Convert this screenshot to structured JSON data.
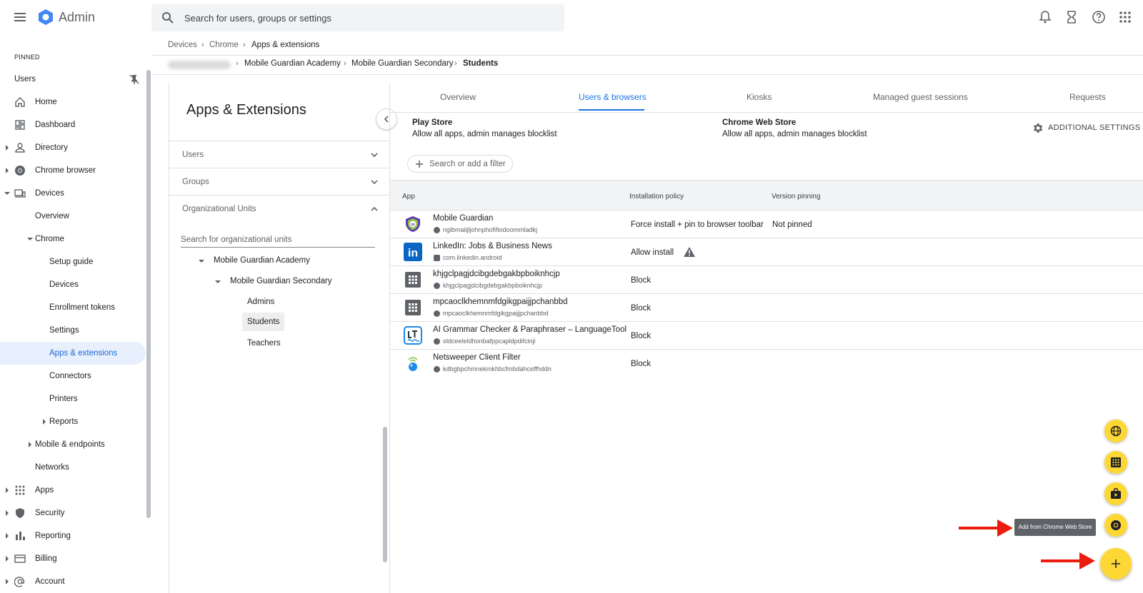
{
  "header": {
    "app_title": "Admin",
    "search_placeholder": "Search for users, groups or settings"
  },
  "sidebar": {
    "pinned_label": "PINNED",
    "pinned_item": "Users",
    "items": [
      {
        "label": "Home"
      },
      {
        "label": "Dashboard"
      },
      {
        "label": "Directory"
      },
      {
        "label": "Chrome browser"
      },
      {
        "label": "Devices"
      },
      {
        "label": "Overview"
      },
      {
        "label": "Chrome"
      },
      {
        "label": "Setup guide"
      },
      {
        "label": "Devices"
      },
      {
        "label": "Enrollment tokens"
      },
      {
        "label": "Settings"
      },
      {
        "label": "Apps & extensions"
      },
      {
        "label": "Connectors"
      },
      {
        "label": "Printers"
      },
      {
        "label": "Reports"
      },
      {
        "label": "Mobile & endpoints"
      },
      {
        "label": "Networks"
      },
      {
        "label": "Apps"
      },
      {
        "label": "Security"
      },
      {
        "label": "Reporting"
      },
      {
        "label": "Billing"
      },
      {
        "label": "Account"
      }
    ]
  },
  "breadcrumb1": [
    "Devices",
    "Chrome",
    "Apps & extensions"
  ],
  "breadcrumb2": [
    "Mobile Guardian Academy",
    "Mobile Guardian Secondary",
    "Students"
  ],
  "left_panel": {
    "title": "Apps & Extensions",
    "sections": [
      "Users",
      "Groups",
      "Organizational Units"
    ],
    "ou_search_placeholder": "Search for organizational units",
    "ou_tree": [
      "Mobile Guardian Academy",
      "Mobile Guardian Secondary",
      "Admins",
      "Students",
      "Teachers"
    ]
  },
  "tabs": [
    "Overview",
    "Users & browsers",
    "Kiosks",
    "Managed guest sessions",
    "Requests"
  ],
  "stores": [
    {
      "title": "Play Store",
      "desc": "Allow all apps, admin manages blocklist"
    },
    {
      "title": "Chrome Web Store",
      "desc": "Allow all apps, admin manages blocklist"
    }
  ],
  "additional_settings": "ADDITIONAL SETTINGS",
  "filter_placeholder": "Search or add a filter",
  "table": {
    "headers": [
      "App",
      "Installation policy",
      "Version pinning"
    ],
    "rows": [
      {
        "name": "Mobile Guardian",
        "id": "nglbmaiijljohnphofifiodoommladkj",
        "policy": "Force install + pin to browser toolbar",
        "pin": "Not pinned"
      },
      {
        "name": "LinkedIn: Jobs & Business News",
        "id": "com.linkedin.android",
        "policy": "Allow install",
        "pin": ""
      },
      {
        "name": "khjgclpagjdcibgdebgakbpboiknhcjp",
        "id": "khjgclpagjdcibgdebgakbpboiknhcjp",
        "policy": "Block",
        "pin": ""
      },
      {
        "name": "mpcaoclkhemnmfdgikgpaijjpchanbbd",
        "id": "mpcaoclkhemnmfdgikgpaijjpchanbbd",
        "policy": "Block",
        "pin": ""
      },
      {
        "name": "AI Grammar Checker & Paraphraser – LanguageTool",
        "id": "oldceeleldhonbafppcapldpdifcinji",
        "policy": "Block",
        "pin": ""
      },
      {
        "name": "Netsweeper Client Filter",
        "id": "kdbgbpchmnekmkhbcfmbdahceffhddn",
        "policy": "Block",
        "pin": ""
      }
    ]
  },
  "fab_tooltip": "Add from Chrome Web Store",
  "colors": {
    "accent": "#1a73e8",
    "fab": "#fdd835",
    "arrow": "#ea1d0e"
  }
}
